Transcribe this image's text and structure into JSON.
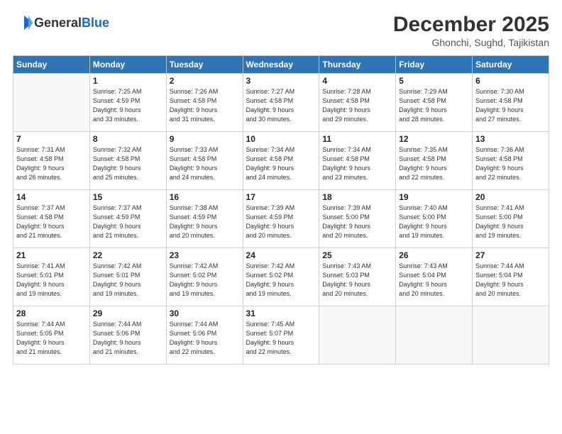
{
  "header": {
    "logo_general": "General",
    "logo_blue": "Blue",
    "month_title": "December 2025",
    "location": "Ghonchi, Sughd, Tajikistan"
  },
  "weekdays": [
    "Sunday",
    "Monday",
    "Tuesday",
    "Wednesday",
    "Thursday",
    "Friday",
    "Saturday"
  ],
  "weeks": [
    [
      {
        "day": "",
        "info": ""
      },
      {
        "day": "1",
        "info": "Sunrise: 7:25 AM\nSunset: 4:59 PM\nDaylight: 9 hours\nand 33 minutes."
      },
      {
        "day": "2",
        "info": "Sunrise: 7:26 AM\nSunset: 4:58 PM\nDaylight: 9 hours\nand 31 minutes."
      },
      {
        "day": "3",
        "info": "Sunrise: 7:27 AM\nSunset: 4:58 PM\nDaylight: 9 hours\nand 30 minutes."
      },
      {
        "day": "4",
        "info": "Sunrise: 7:28 AM\nSunset: 4:58 PM\nDaylight: 9 hours\nand 29 minutes."
      },
      {
        "day": "5",
        "info": "Sunrise: 7:29 AM\nSunset: 4:58 PM\nDaylight: 9 hours\nand 28 minutes."
      },
      {
        "day": "6",
        "info": "Sunrise: 7:30 AM\nSunset: 4:58 PM\nDaylight: 9 hours\nand 27 minutes."
      }
    ],
    [
      {
        "day": "7",
        "info": "Sunrise: 7:31 AM\nSunset: 4:58 PM\nDaylight: 9 hours\nand 26 minutes."
      },
      {
        "day": "8",
        "info": "Sunrise: 7:32 AM\nSunset: 4:58 PM\nDaylight: 9 hours\nand 25 minutes."
      },
      {
        "day": "9",
        "info": "Sunrise: 7:33 AM\nSunset: 4:58 PM\nDaylight: 9 hours\nand 24 minutes."
      },
      {
        "day": "10",
        "info": "Sunrise: 7:34 AM\nSunset: 4:58 PM\nDaylight: 9 hours\nand 24 minutes."
      },
      {
        "day": "11",
        "info": "Sunrise: 7:34 AM\nSunset: 4:58 PM\nDaylight: 9 hours\nand 23 minutes."
      },
      {
        "day": "12",
        "info": "Sunrise: 7:35 AM\nSunset: 4:58 PM\nDaylight: 9 hours\nand 22 minutes."
      },
      {
        "day": "13",
        "info": "Sunrise: 7:36 AM\nSunset: 4:58 PM\nDaylight: 9 hours\nand 22 minutes."
      }
    ],
    [
      {
        "day": "14",
        "info": "Sunrise: 7:37 AM\nSunset: 4:58 PM\nDaylight: 9 hours\nand 21 minutes."
      },
      {
        "day": "15",
        "info": "Sunrise: 7:37 AM\nSunset: 4:59 PM\nDaylight: 9 hours\nand 21 minutes."
      },
      {
        "day": "16",
        "info": "Sunrise: 7:38 AM\nSunset: 4:59 PM\nDaylight: 9 hours\nand 20 minutes."
      },
      {
        "day": "17",
        "info": "Sunrise: 7:39 AM\nSunset: 4:59 PM\nDaylight: 9 hours\nand 20 minutes."
      },
      {
        "day": "18",
        "info": "Sunrise: 7:39 AM\nSunset: 5:00 PM\nDaylight: 9 hours\nand 20 minutes."
      },
      {
        "day": "19",
        "info": "Sunrise: 7:40 AM\nSunset: 5:00 PM\nDaylight: 9 hours\nand 19 minutes."
      },
      {
        "day": "20",
        "info": "Sunrise: 7:41 AM\nSunset: 5:00 PM\nDaylight: 9 hours\nand 19 minutes."
      }
    ],
    [
      {
        "day": "21",
        "info": "Sunrise: 7:41 AM\nSunset: 5:01 PM\nDaylight: 9 hours\nand 19 minutes."
      },
      {
        "day": "22",
        "info": "Sunrise: 7:42 AM\nSunset: 5:01 PM\nDaylight: 9 hours\nand 19 minutes."
      },
      {
        "day": "23",
        "info": "Sunrise: 7:42 AM\nSunset: 5:02 PM\nDaylight: 9 hours\nand 19 minutes."
      },
      {
        "day": "24",
        "info": "Sunrise: 7:42 AM\nSunset: 5:02 PM\nDaylight: 9 hours\nand 19 minutes."
      },
      {
        "day": "25",
        "info": "Sunrise: 7:43 AM\nSunset: 5:03 PM\nDaylight: 9 hours\nand 20 minutes."
      },
      {
        "day": "26",
        "info": "Sunrise: 7:43 AM\nSunset: 5:04 PM\nDaylight: 9 hours\nand 20 minutes."
      },
      {
        "day": "27",
        "info": "Sunrise: 7:44 AM\nSunset: 5:04 PM\nDaylight: 9 hours\nand 20 minutes."
      }
    ],
    [
      {
        "day": "28",
        "info": "Sunrise: 7:44 AM\nSunset: 5:05 PM\nDaylight: 9 hours\nand 21 minutes."
      },
      {
        "day": "29",
        "info": "Sunrise: 7:44 AM\nSunset: 5:06 PM\nDaylight: 9 hours\nand 21 minutes."
      },
      {
        "day": "30",
        "info": "Sunrise: 7:44 AM\nSunset: 5:06 PM\nDaylight: 9 hours\nand 22 minutes."
      },
      {
        "day": "31",
        "info": "Sunrise: 7:45 AM\nSunset: 5:07 PM\nDaylight: 9 hours\nand 22 minutes."
      },
      {
        "day": "",
        "info": ""
      },
      {
        "day": "",
        "info": ""
      },
      {
        "day": "",
        "info": ""
      }
    ]
  ]
}
